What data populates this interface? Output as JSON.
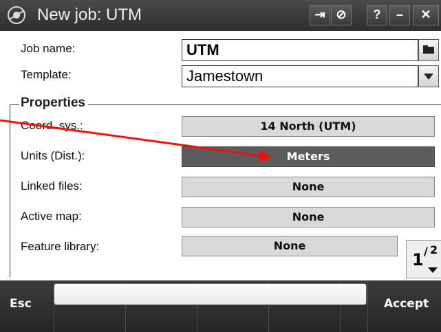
{
  "window": {
    "title": "New job: UTM",
    "buttons": [
      {
        "name": "logout-button",
        "glyph": "⇥"
      },
      {
        "name": "gps-status-button",
        "glyph": "⊘"
      },
      {
        "name": "help-button",
        "glyph": "?"
      },
      {
        "name": "minimize-button",
        "glyph": "–"
      },
      {
        "name": "close-button",
        "glyph": "✕"
      }
    ]
  },
  "form": {
    "job_name_label": "Job name:",
    "job_name_value": "UTM",
    "template_label": "Template:",
    "template_value": "Jamestown"
  },
  "properties": {
    "title": "Properties",
    "rows": [
      {
        "label": "Coord. sys.:",
        "value": "14 North (UTM)",
        "selected": false
      },
      {
        "label": "Units (Dist.):",
        "value": "Meters",
        "selected": true
      },
      {
        "label": "Linked files:",
        "value": "None",
        "selected": false
      },
      {
        "label": "Active map:",
        "value": "None",
        "selected": false
      },
      {
        "label": "Feature library:",
        "value": "None",
        "selected": false
      }
    ],
    "page_indicator": {
      "current": "1",
      "total": "2"
    }
  },
  "bottom": {
    "esc_label": "Esc",
    "accept_label": "Accept"
  },
  "annotation": {
    "color": "#e8140c"
  },
  "colors": {
    "titlebar": "#3a3a3a",
    "selected_button": "#5c5c5c",
    "button": "#d9d9d9"
  }
}
